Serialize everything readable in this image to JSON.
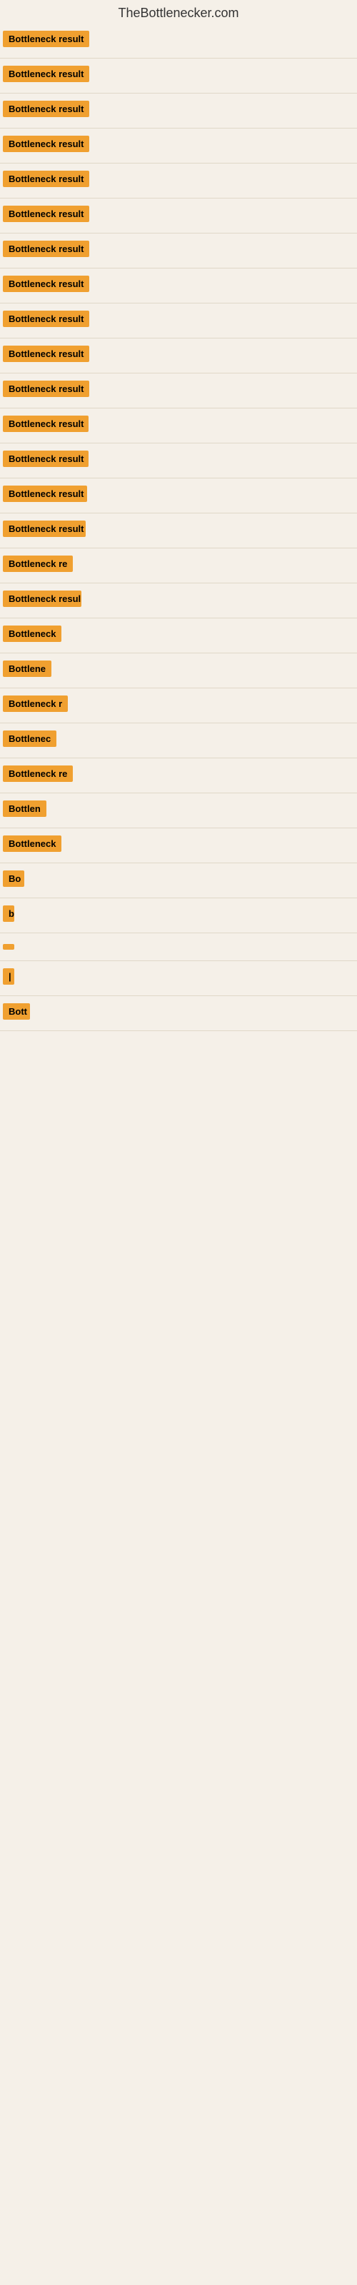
{
  "site": {
    "title": "TheBottlenecker.com"
  },
  "rows": [
    {
      "id": 1,
      "label": "Bottleneck result",
      "width": 130,
      "font_size": 13
    },
    {
      "id": 2,
      "label": "Bottleneck result",
      "width": 130,
      "font_size": 13
    },
    {
      "id": 3,
      "label": "Bottleneck result",
      "width": 130,
      "font_size": 13
    },
    {
      "id": 4,
      "label": "Bottleneck result",
      "width": 130,
      "font_size": 13
    },
    {
      "id": 5,
      "label": "Bottleneck result",
      "width": 130,
      "font_size": 13
    },
    {
      "id": 6,
      "label": "Bottleneck result",
      "width": 130,
      "font_size": 13
    },
    {
      "id": 7,
      "label": "Bottleneck result",
      "width": 130,
      "font_size": 13
    },
    {
      "id": 8,
      "label": "Bottleneck result",
      "width": 130,
      "font_size": 13
    },
    {
      "id": 9,
      "label": "Bottleneck result",
      "width": 130,
      "font_size": 13
    },
    {
      "id": 10,
      "label": "Bottleneck result",
      "width": 130,
      "font_size": 13
    },
    {
      "id": 11,
      "label": "Bottleneck result",
      "width": 130,
      "font_size": 13
    },
    {
      "id": 12,
      "label": "Bottleneck result",
      "width": 120,
      "font_size": 13
    },
    {
      "id": 13,
      "label": "Bottleneck result",
      "width": 120,
      "font_size": 13
    },
    {
      "id": 14,
      "label": "Bottleneck result",
      "width": 118,
      "font_size": 13
    },
    {
      "id": 15,
      "label": "Bottleneck result",
      "width": 116,
      "font_size": 13
    },
    {
      "id": 16,
      "label": "Bottleneck re",
      "width": 100,
      "font_size": 13
    },
    {
      "id": 17,
      "label": "Bottleneck resul",
      "width": 110,
      "font_size": 13
    },
    {
      "id": 18,
      "label": "Bottleneck",
      "width": 85,
      "font_size": 13
    },
    {
      "id": 19,
      "label": "Bottlene",
      "width": 75,
      "font_size": 13
    },
    {
      "id": 20,
      "label": "Bottleneck r",
      "width": 92,
      "font_size": 13
    },
    {
      "id": 21,
      "label": "Bottlenec",
      "width": 78,
      "font_size": 13
    },
    {
      "id": 22,
      "label": "Bottleneck re",
      "width": 100,
      "font_size": 13
    },
    {
      "id": 23,
      "label": "Bottlen",
      "width": 68,
      "font_size": 13
    },
    {
      "id": 24,
      "label": "Bottleneck",
      "width": 85,
      "font_size": 13
    },
    {
      "id": 25,
      "label": "Bo",
      "width": 30,
      "font_size": 13
    },
    {
      "id": 26,
      "label": "b",
      "width": 16,
      "font_size": 13
    },
    {
      "id": 27,
      "label": "",
      "width": 8,
      "font_size": 13
    },
    {
      "id": 28,
      "label": "|",
      "width": 10,
      "font_size": 13
    },
    {
      "id": 29,
      "label": "Bott",
      "width": 38,
      "font_size": 13
    }
  ],
  "accent_color": "#f0a030"
}
